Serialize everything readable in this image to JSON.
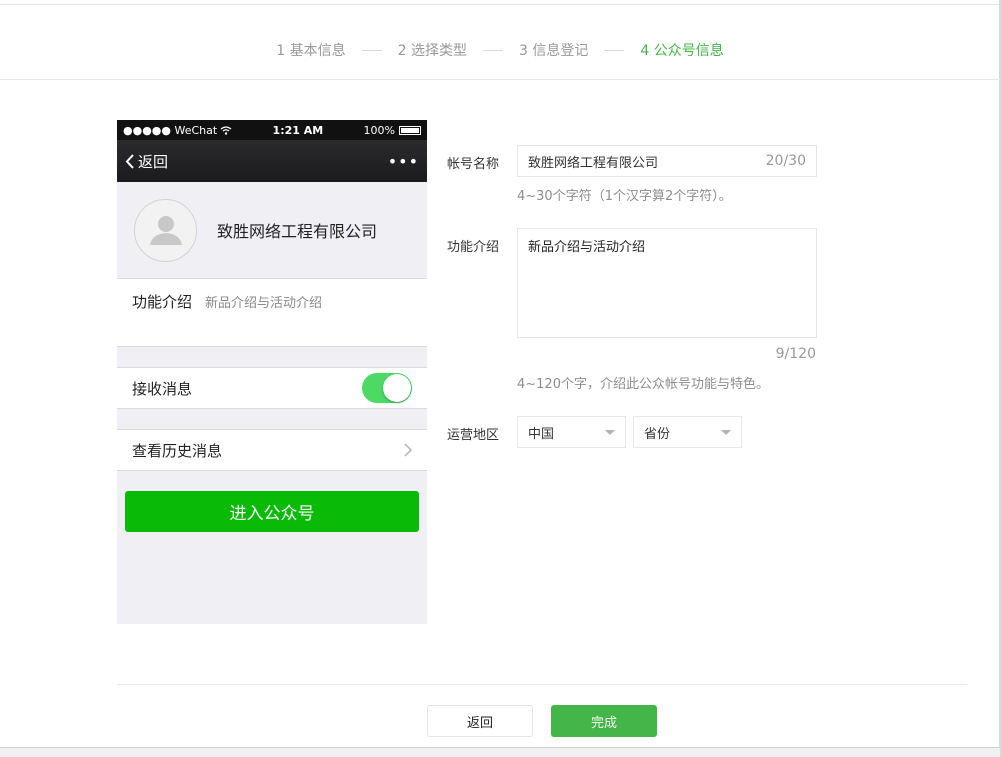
{
  "steps": [
    {
      "label": "1 基本信息",
      "active": false
    },
    {
      "label": "2 选择类型",
      "active": false
    },
    {
      "label": "3 信息登记",
      "active": false
    },
    {
      "label": "4 公众号信息",
      "active": true
    }
  ],
  "phone": {
    "status": {
      "carrier": "●●●●● WeChat",
      "time": "1:21 AM",
      "battery": "100%"
    },
    "nav": {
      "back": "返回",
      "more": "•••"
    },
    "profile_name": "致胜网络工程有限公司",
    "intro_label": "功能介绍",
    "intro_text": "新品介绍与活动介绍",
    "receive_label": "接收消息",
    "receive_on": true,
    "history_label": "查看历史消息",
    "enter_button": "进入公众号"
  },
  "form": {
    "name_label": "帐号名称",
    "name_value": "致胜网络工程有限公司",
    "name_counter": "20/30",
    "name_hint": "4~30个字符（1个汉字算2个字符）。",
    "intro_label": "功能介绍",
    "intro_value": "新品介绍与活动介绍",
    "intro_counter": "9/120",
    "intro_hint": "4~120个字，介绍此公众帐号功能与特色。",
    "region_label": "运营地区",
    "country": "中国",
    "province": "省份"
  },
  "footer": {
    "back": "返回",
    "done": "完成"
  },
  "colors": {
    "accent": "#44b549",
    "enter_button": "#09bb07",
    "toggle": "#4cd964"
  }
}
